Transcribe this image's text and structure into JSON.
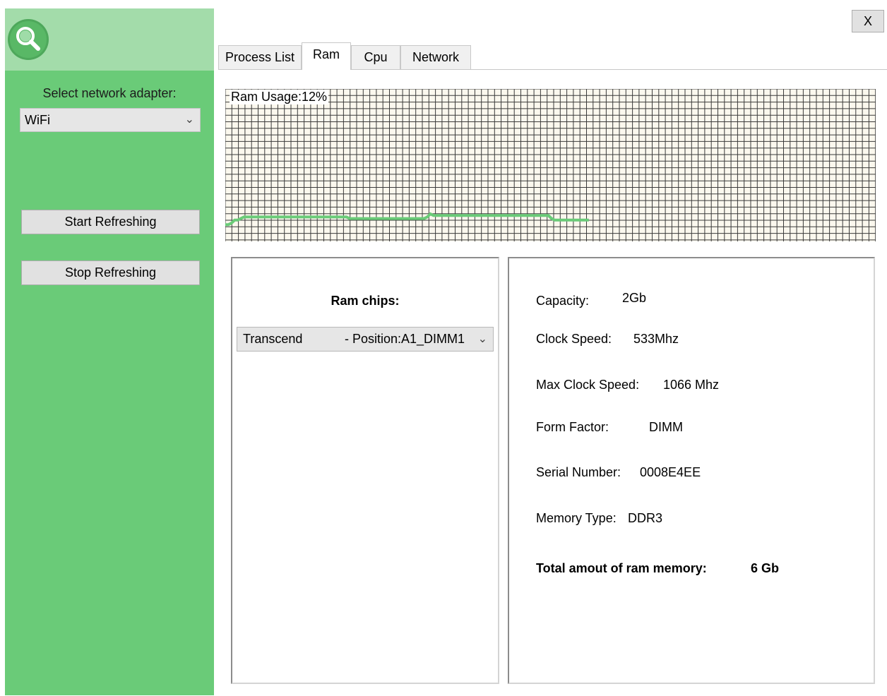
{
  "window": {
    "close_label": "X"
  },
  "sidebar": {
    "logo_icon": "search-icon",
    "adapter_label": "Select network adapter:",
    "adapter_selected": "WiFi",
    "start_label": "Start Refreshing",
    "stop_label": "Stop Refreshing",
    "colors": {
      "panel": "#6acb78",
      "header": "#a3dcaa"
    }
  },
  "tabs": [
    {
      "label": "Process List",
      "active": false
    },
    {
      "label": "Ram",
      "active": true
    },
    {
      "label": "Cpu",
      "active": false
    },
    {
      "label": "Network",
      "active": false
    }
  ],
  "ram_chart": {
    "title": "Ram Usage:12%",
    "line_color": "#6acb78",
    "grid_color": "#3a3a3a",
    "background": "#fbf8ee",
    "samples": [
      11,
      11,
      12,
      14,
      14,
      15,
      16,
      16,
      16,
      16,
      16,
      16,
      16,
      16,
      16,
      16,
      16,
      16,
      16,
      16,
      16,
      16,
      16,
      16,
      16,
      16,
      16,
      16,
      16,
      16,
      16,
      16,
      16,
      16,
      16,
      16,
      16,
      16,
      16,
      16,
      15,
      15,
      15,
      15,
      15,
      15,
      15,
      15,
      15,
      15,
      15,
      15,
      15,
      15,
      15,
      15,
      15,
      15,
      15,
      15,
      15,
      15,
      15,
      15,
      15,
      16,
      18,
      17,
      17,
      17,
      17,
      17,
      17,
      17,
      17,
      17,
      17,
      17,
      17,
      17,
      17,
      17,
      17,
      17,
      17,
      17,
      17,
      17,
      17,
      17,
      17,
      17,
      17,
      17,
      17,
      17,
      17,
      17,
      17,
      17,
      17,
      17,
      17,
      17,
      17,
      15,
      14,
      14,
      14,
      14,
      14,
      14,
      14,
      14,
      14,
      14,
      14,
      14
    ]
  },
  "chips": {
    "title": "Ram chips:",
    "selected_name": "Transcend",
    "selected_position": "- Position:A1_DIMM1"
  },
  "details": {
    "capacity_label": "Capacity:",
    "capacity_value": "2Gb",
    "clock_label": "Clock Speed:",
    "clock_value": "533Mhz",
    "max_clock_label": "Max Clock Speed:",
    "max_clock_value": "1066 Mhz",
    "form_label": "Form Factor:",
    "form_value": "DIMM",
    "serial_label": "Serial Number:",
    "serial_value": "0008E4EE",
    "type_label": "Memory Type:",
    "type_value": "DDR3",
    "total_label": "Total amout of ram memory:",
    "total_value": "6 Gb"
  }
}
